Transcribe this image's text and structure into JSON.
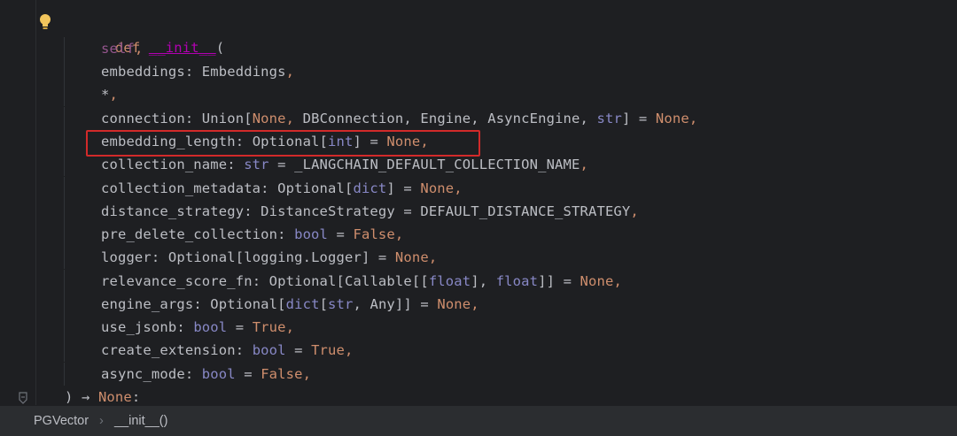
{
  "code": {
    "def_keyword": "def",
    "def_name": "__init__",
    "def_open": "(",
    "self": "self",
    "l_embeddings_name": "embeddings",
    "l_embeddings_type": "Embeddings",
    "l_star": "*",
    "l_connection_name": "connection",
    "l_connection_union": "Union",
    "l_connection_none": "None",
    "l_connection_types": "DBConnection, Engine, AsyncEngine,",
    "l_connection_str": "str",
    "l_embedding_length_name": "embedding_length",
    "l_embedding_length_type": "Optional",
    "l_embedding_length_int": "int",
    "l_collection_name_name": "collection_name",
    "l_collection_name_default": "_LANGCHAIN_DEFAULT_COLLECTION_NAME",
    "l_collection_metadata_name": "collection_metadata",
    "l_collection_metadata_dict": "dict",
    "l_distance_strategy_name": "distance_strategy",
    "l_distance_strategy_type": "DistanceStrategy",
    "l_distance_strategy_default": "DEFAULT_DISTANCE_STRATEGY",
    "l_pre_delete_name": "pre_delete_collection",
    "l_bool": "bool",
    "l_false": "False",
    "l_true": "True",
    "l_none": "None",
    "l_logger_name": "logger",
    "l_logger_type": "logging.Logger",
    "l_relevance_name": "relevance_score_fn",
    "l_callable": "Callable",
    "l_float": "float",
    "l_engine_args_name": "engine_args",
    "l_any": "Any",
    "l_use_jsonb_name": "use_jsonb",
    "l_create_extension_name": "create_extension",
    "l_async_mode_name": "async_mode",
    "l_return_arrow": ") → ",
    "l_return_none": "None",
    "l_optional": "Optional"
  },
  "breadcrumb": {
    "class_name": "PGVector",
    "separator": "›",
    "method_name": "__init__()"
  },
  "colors": {
    "highlight_box": "#d22a2a",
    "keyword": "#cf8e6d",
    "builtin": "#8888c6",
    "self": "#94558d"
  }
}
